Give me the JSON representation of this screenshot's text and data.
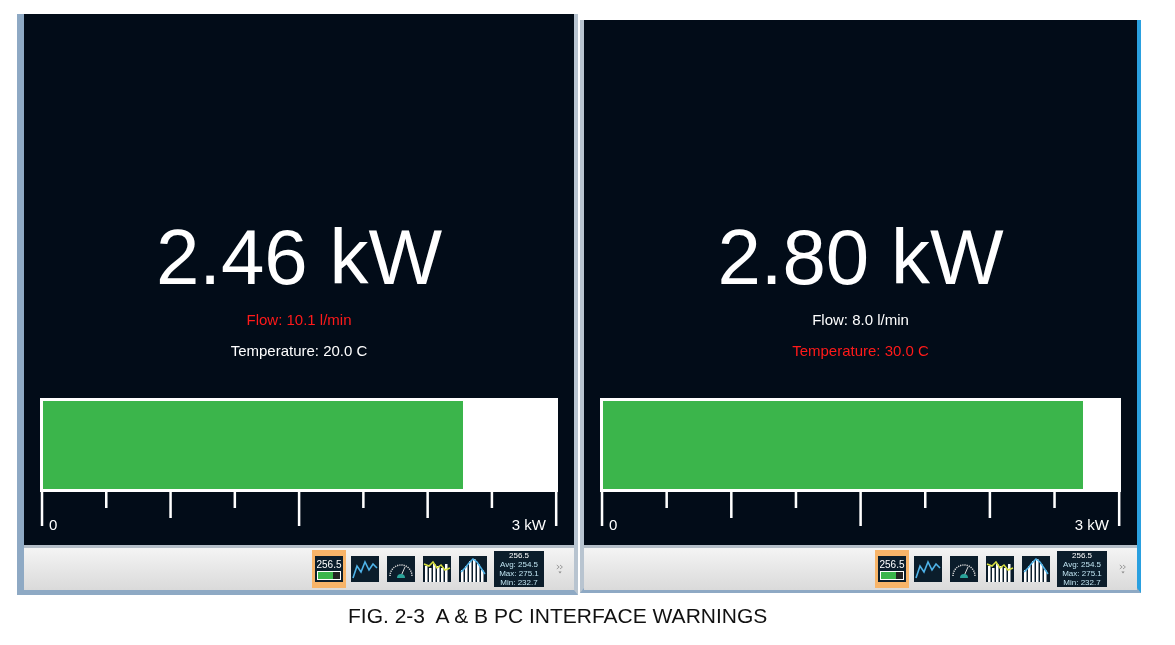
{
  "panels": [
    {
      "value": "2.46 kW",
      "readings": [
        {
          "text": "Flow: 10.1 l/min",
          "warning": true
        },
        {
          "text": "Temperature: 20.0 C",
          "warning": false
        }
      ],
      "level": 0.82,
      "scale_min": "0",
      "scale_max": "3 kW",
      "toolbar": [
        {
          "kind": "value",
          "selected": true,
          "value": "256.5"
        },
        {
          "kind": "line",
          "selected": false
        },
        {
          "kind": "gauge",
          "selected": false
        },
        {
          "kind": "barline",
          "selected": false
        },
        {
          "kind": "bars",
          "selected": false
        },
        {
          "kind": "stats",
          "selected": false,
          "value": "256.5",
          "lines": [
            "Avg: 254.5",
            "Max: 275.1",
            "Min: 232.7"
          ]
        }
      ]
    },
    {
      "value": "2.80 kW",
      "readings": [
        {
          "text": "Flow: 8.0 l/min",
          "warning": false
        },
        {
          "text": "Temperature: 30.0 C",
          "warning": true
        }
      ],
      "level": 0.933,
      "scale_min": "0",
      "scale_max": "3 kW",
      "toolbar": [
        {
          "kind": "value",
          "selected": true,
          "value": "256.5"
        },
        {
          "kind": "line",
          "selected": false
        },
        {
          "kind": "gauge",
          "selected": false
        },
        {
          "kind": "barline",
          "selected": false
        },
        {
          "kind": "bars",
          "selected": false
        },
        {
          "kind": "stats",
          "selected": false,
          "value": "256.5",
          "lines": [
            "Avg: 254.5",
            "Max: 275.1",
            "Min: 232.7"
          ]
        }
      ]
    }
  ],
  "caption": "FIG. 2-3  A & B PC INTERFACE WARNINGS"
}
